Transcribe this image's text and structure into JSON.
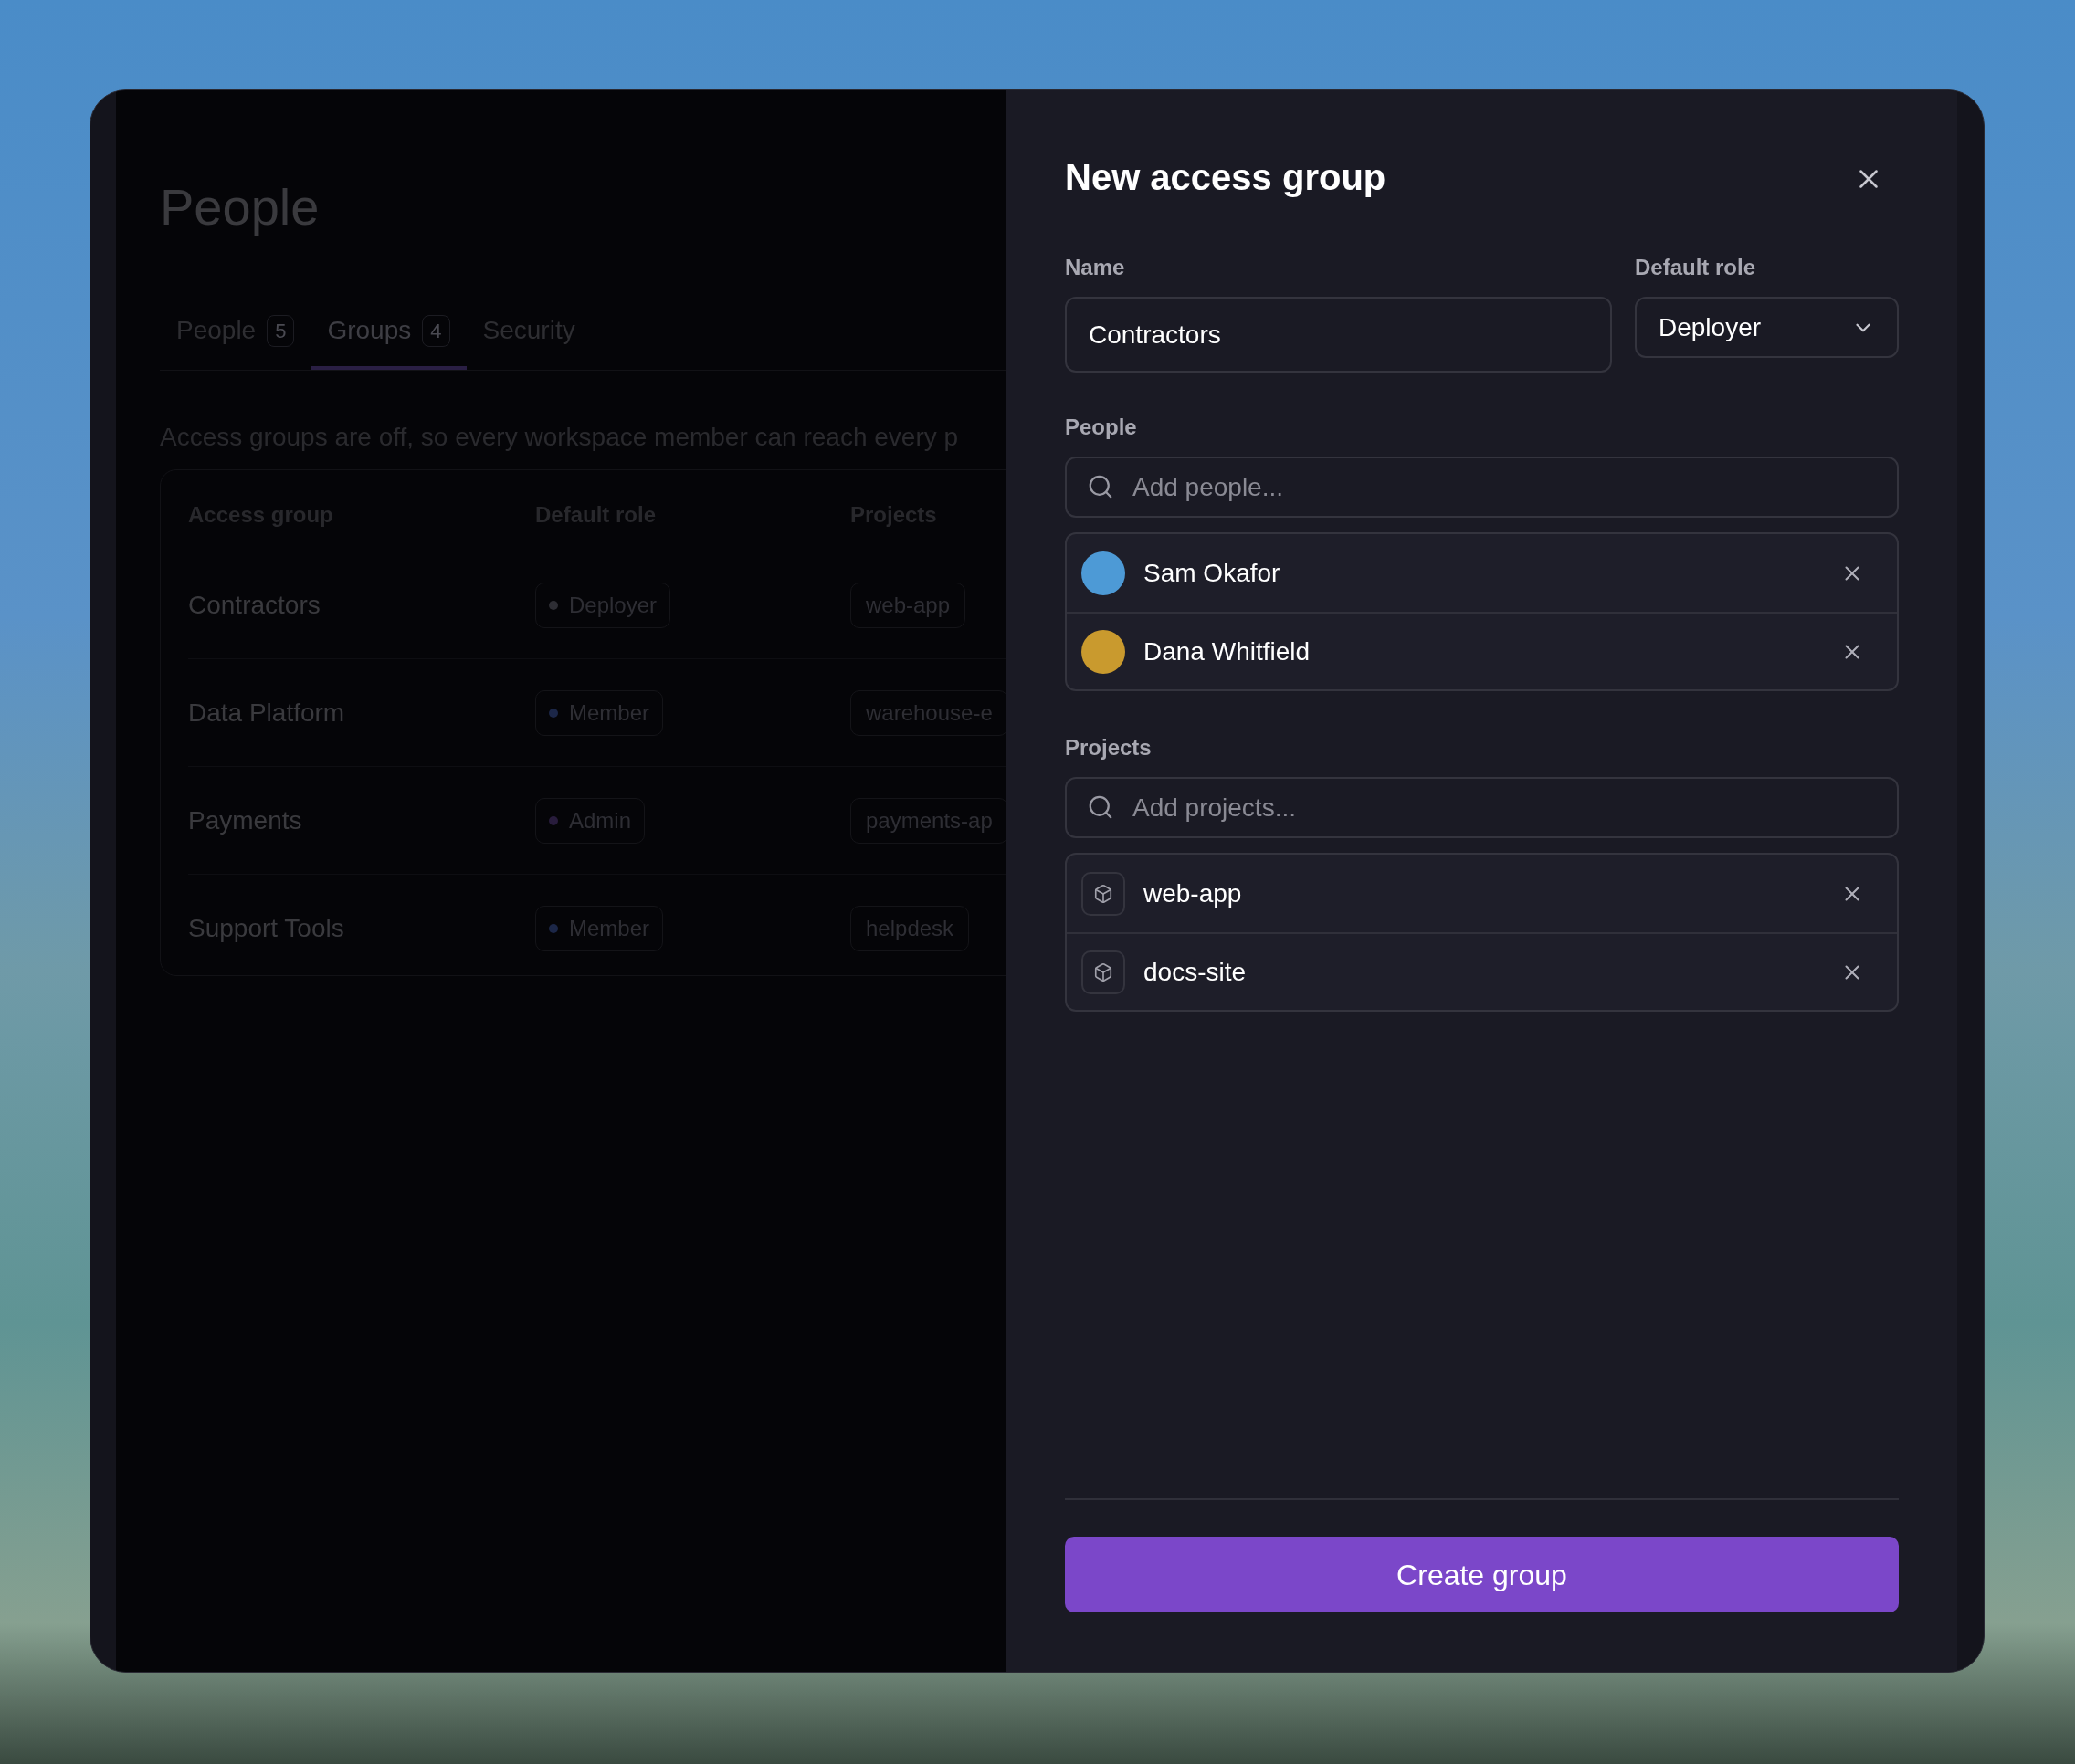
{
  "page": {
    "title": "People",
    "tabs": [
      {
        "label": "People",
        "count": "5",
        "selected": false
      },
      {
        "label": "Groups",
        "count": "4",
        "selected": true
      },
      {
        "label": "Security",
        "selected": false
      }
    ],
    "notice": "Access groups are off, so every workspace member can reach every p",
    "table": {
      "columns": [
        "Access group",
        "Default role",
        "Projects"
      ],
      "rows": [
        {
          "name": "Contractors",
          "role": "Deployer",
          "color": "#2e2e34",
          "projects": [
            "web-app"
          ]
        },
        {
          "name": "Data Platform",
          "role": "Member",
          "color": "#1c2748",
          "projects": [
            "warehouse-e"
          ]
        },
        {
          "name": "Payments",
          "role": "Admin",
          "color": "#281c3c",
          "projects": [
            "payments-ap"
          ]
        },
        {
          "name": "Support Tools",
          "role": "Member",
          "color": "#1c2748",
          "projects": [
            "helpdesk"
          ]
        }
      ]
    }
  },
  "drawer": {
    "title": "New access group",
    "name_label": "Name",
    "name_value": "Contractors",
    "role_label": "Default role",
    "role_value": "Deployer",
    "people_label": "People",
    "people_placeholder": "Add people...",
    "people": [
      {
        "name": "Sam Okafor",
        "color": "#4d9ad6"
      },
      {
        "name": "Dana Whitfield",
        "color": "#c99a2e"
      }
    ],
    "projects_label": "Projects",
    "projects_placeholder": "Add projects...",
    "projects": [
      "web-app",
      "docs-site"
    ],
    "submit": "Create group"
  }
}
